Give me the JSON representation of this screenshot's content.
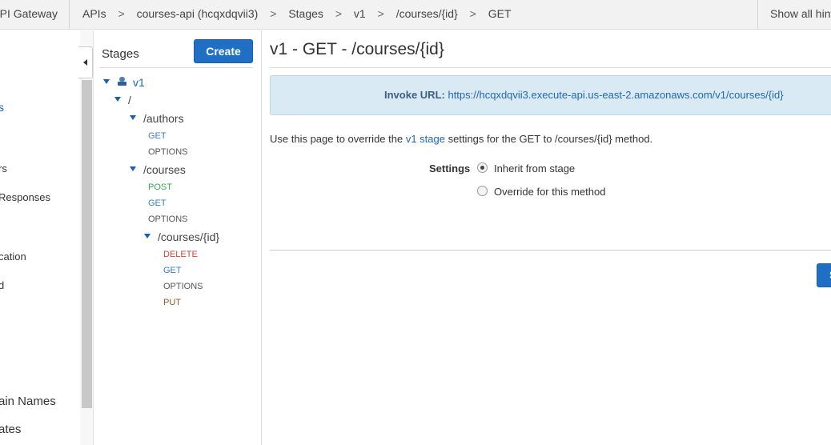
{
  "topbar": {
    "service": "API Gateway",
    "breadcrumbs": [
      "APIs",
      "courses-api (hcqxdqvii3)",
      "Stages",
      "v1",
      "/courses/{id}",
      "GET"
    ],
    "separator": ">",
    "show_hints": "Show all hints"
  },
  "leftnav": {
    "items": [
      "s",
      "rs",
      "Responses",
      "cation",
      "d",
      "ain Names",
      "ates"
    ]
  },
  "stages_panel": {
    "heading": "Stages",
    "create_label": "Create",
    "stage": "v1",
    "root": "/",
    "authors": "/authors",
    "courses": "/courses",
    "course_id": "/courses/{id}",
    "methods": {
      "authors": [
        "GET",
        "OPTIONS"
      ],
      "courses": [
        "POST",
        "GET",
        "OPTIONS"
      ],
      "course_id": [
        "DELETE",
        "GET",
        "OPTIONS",
        "PUT"
      ]
    }
  },
  "main": {
    "title": "v1 - GET - /courses/{id}",
    "invoke_label": "Invoke URL:",
    "invoke_url": "https://hcqxdqvii3.execute-api.us-east-2.amazonaws.com/v1/courses/{id}",
    "desc_before": "Use this page to override the ",
    "desc_link": "v1 stage",
    "desc_after": " settings for the GET to /courses/{id} method.",
    "settings_label": "Settings",
    "options": [
      "Inherit from stage",
      "Override for this method"
    ],
    "selected_option": "Inherit from stage",
    "save_label": "Save"
  },
  "colors": {
    "primary_button": "#1f6fc5",
    "link": "#2067b5",
    "invoke_bg": "#daeaf5",
    "method_get": "#3b7dc4",
    "method_post": "#3aa55a",
    "method_delete": "#d9413b",
    "method_put": "#8a5a2b"
  }
}
